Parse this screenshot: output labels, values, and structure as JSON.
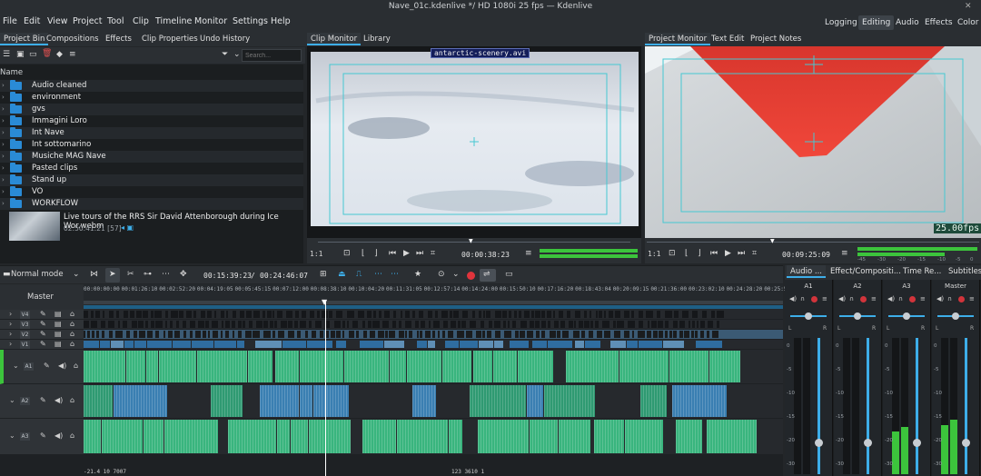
{
  "window": {
    "title": "Nave_01c.kdenlive */ HD 1080i 25 fps — Kdenlive"
  },
  "menu": [
    "File",
    "Edit",
    "View",
    "Project",
    "Tool",
    "Clip",
    "Timeline",
    "Monitor",
    "Settings",
    "Help"
  ],
  "workspaces": {
    "items": [
      "Logging",
      "Editing",
      "Audio",
      "Effects",
      "Color"
    ],
    "active": "Editing"
  },
  "left_tabs": [
    "Project Bin",
    "Compositions",
    "Effects",
    "Clip Properties",
    "Undo History"
  ],
  "bin": {
    "search_placeholder": "Search...",
    "column_header": "Name",
    "folders": [
      "Audio cleaned",
      "environment",
      "gvs",
      "Immagini Loro",
      "Int Nave",
      "Int sottomarino",
      "Musiche MAG Nave",
      "Pasted clips",
      "Stand up",
      "VO",
      "WORKFLOW"
    ],
    "clip": {
      "name": "Live tours of the RRS Sir David Attenborough during Ice Wor.webm",
      "duration": "02:50:41:21 [57]"
    }
  },
  "clip_monitor": {
    "tabs": [
      "Clip Monitor",
      "Library"
    ],
    "clip_name": "antarctic-scenery.avi",
    "timecode": "00:00:38:23",
    "zoom": "1:1"
  },
  "project_monitor": {
    "tabs": [
      "Project Monitor",
      "Text Edit",
      "Project Notes"
    ],
    "fps_overlay": "25.00fps",
    "timecode": "00:09:25:09",
    "zoom": "1:1",
    "meter_scale": [
      "-45",
      "-30",
      "-20",
      "-15",
      "-10",
      "-5",
      "0"
    ]
  },
  "timeline": {
    "mode": "Normal mode",
    "position": "00:15:39:23",
    "duration": "00:24:46:07",
    "master_label": "Master",
    "ruler": [
      "00:00:00:00",
      "00:01:26:10",
      "00:02:52:20",
      "00:04:19:05",
      "00:05:45:15",
      "00:07:12:00",
      "00:08:38:10",
      "00:10:04:20",
      "00:11:31:05",
      "00:12:57:14",
      "00:14:24:00",
      "00:15:50:10",
      "00:17:16:20",
      "00:18:43:04",
      "00:20:09:15",
      "00:21:36:00",
      "00:23:02:10",
      "00:24:28:20",
      "00:25:55:04"
    ],
    "tracks": [
      "V4",
      "V3",
      "V2",
      "V1",
      "A1",
      "A2",
      "A3"
    ],
    "footer_labels": [
      "-21.4 10 7007",
      "123 3610 1"
    ]
  },
  "mixer": {
    "tabs": [
      "Audio ...",
      "Effect/Compositi...",
      "Time Re...",
      "Subtitles"
    ],
    "channels": [
      "A1",
      "A2",
      "A3",
      "Master"
    ],
    "meter_levels": [
      0.0,
      0.0,
      0.35,
      0.4
    ],
    "db_ticks": [
      "0",
      "-5",
      "-10",
      "-15",
      "-20",
      "-30"
    ],
    "lr": [
      "L",
      "R"
    ]
  },
  "colors": {
    "accent": "#3daee9",
    "video_clip": "#3f7fb4",
    "audio_clip": "#3ab981",
    "selection": "#2a8bd6",
    "meter": "#3cc43c",
    "monitor_guide": "#46c8d2"
  }
}
